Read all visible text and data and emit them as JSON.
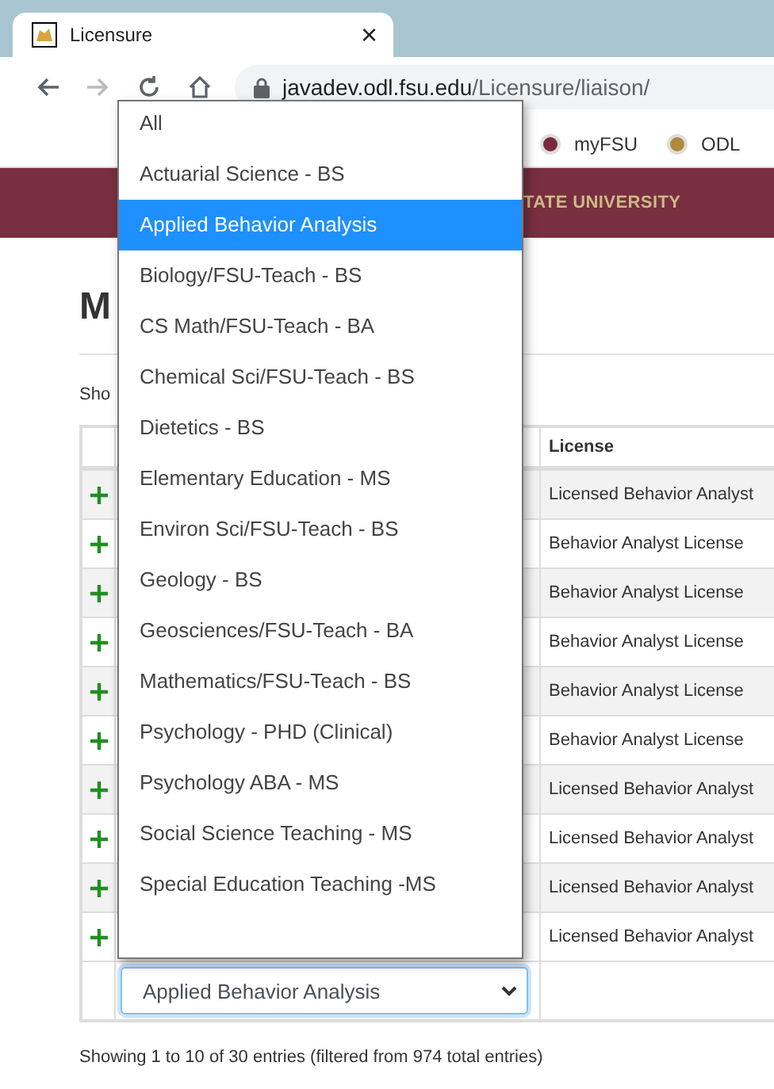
{
  "browser": {
    "tab": {
      "title": "Licensure",
      "close": "×"
    },
    "address": {
      "host": "javadev.odl.fsu.edu",
      "path": "/Licensure/liaison/"
    },
    "bookmarks": [
      {
        "label": "myFSU"
      },
      {
        "label": "ODL"
      }
    ]
  },
  "banner": {
    "text": "TATE UNIVERSITY"
  },
  "page": {
    "heading": "M",
    "length_label": "Sho"
  },
  "table": {
    "columns": [
      "License"
    ],
    "rows": [
      {
        "license": "Licensed Behavior Analyst"
      },
      {
        "license": "Behavior Analyst License"
      },
      {
        "license": "Behavior Analyst License"
      },
      {
        "license": "Behavior Analyst License"
      },
      {
        "license": "Behavior Analyst License"
      },
      {
        "license": "Behavior Analyst License"
      },
      {
        "license": "Licensed Behavior Analyst"
      },
      {
        "license": "Licensed Behavior Analyst"
      },
      {
        "license": "Licensed Behavior Analyst"
      },
      {
        "license": "Licensed Behavior Analyst"
      }
    ],
    "filter": {
      "value": "Applied Behavior Analysis"
    }
  },
  "dropdown": {
    "options": [
      {
        "label": "All",
        "selected": false
      },
      {
        "label": "Actuarial Science - BS",
        "selected": false
      },
      {
        "label": "Applied Behavior Analysis",
        "selected": true
      },
      {
        "label": "Biology/FSU-Teach - BS",
        "selected": false
      },
      {
        "label": "CS Math/FSU-Teach - BA",
        "selected": false
      },
      {
        "label": "Chemical Sci/FSU-Teach - BS",
        "selected": false
      },
      {
        "label": "Dietetics - BS",
        "selected": false
      },
      {
        "label": "Elementary Education - MS",
        "selected": false
      },
      {
        "label": "Environ Sci/FSU-Teach - BS",
        "selected": false
      },
      {
        "label": "Geology - BS",
        "selected": false
      },
      {
        "label": "Geosciences/FSU-Teach - BA",
        "selected": false
      },
      {
        "label": "Mathematics/FSU-Teach - BS",
        "selected": false
      },
      {
        "label": "Psychology - PHD (Clinical)",
        "selected": false
      },
      {
        "label": "Psychology ABA - MS",
        "selected": false
      },
      {
        "label": "Social Science Teaching - MS",
        "selected": false
      },
      {
        "label": "Special Education Teaching -MS",
        "selected": false
      }
    ]
  },
  "info": "Showing 1 to 10 of 30 entries (filtered from 974 total entries)"
}
